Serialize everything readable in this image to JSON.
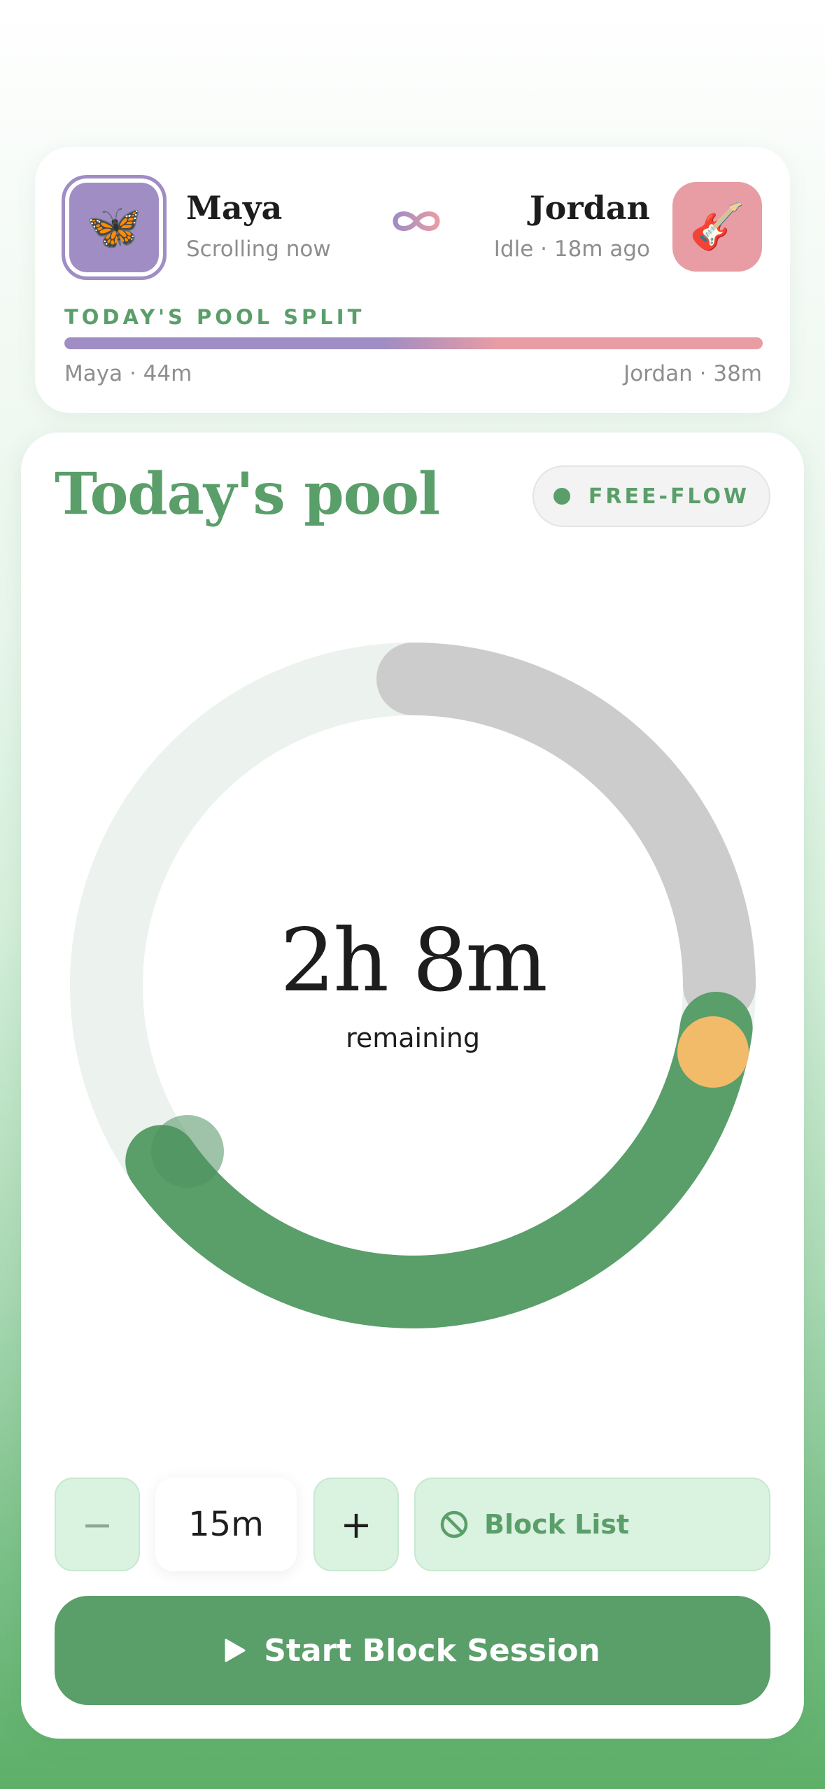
{
  "partners": {
    "left": {
      "name": "Maya",
      "status": "Scrolling now",
      "avatar_emoji": "🦋",
      "avatar_icon": "butterfly-icon",
      "color": "#a08dc4"
    },
    "right": {
      "name": "Jordan",
      "status": "Idle · 18m ago",
      "avatar_emoji": "🎸",
      "avatar_icon": "guitar-icon",
      "color": "#e89ca4"
    },
    "link_icon": "infinity-icon"
  },
  "split": {
    "label": "TODAY'S POOL SPLIT",
    "left_caption": "Maya · 44m",
    "right_caption": "Jordan · 38m",
    "left_share": 0.54
  },
  "pool": {
    "title": "Today's pool",
    "mode_label": "FREE-FLOW",
    "time_remaining": "2h 8m",
    "remaining_label": "remaining"
  },
  "controls": {
    "decrement_label": "−",
    "duration": "15m",
    "increment_label": "+",
    "block_list_label": "Block List",
    "block_list_icon": "block-icon",
    "start_label": "Start Block Session",
    "start_icon": "play-icon"
  },
  "colors": {
    "accent_green": "#5a9e6a",
    "ring_track": "#ecf2ee",
    "ring_used": "#cccccc",
    "ring_remaining": "#5a9e6a",
    "marker": "#f2bb6a",
    "maya": "#a08dc4",
    "jordan": "#e89ca4"
  }
}
